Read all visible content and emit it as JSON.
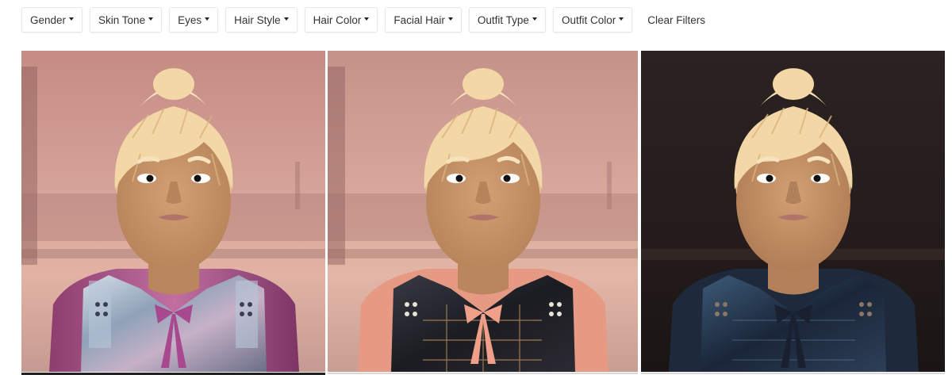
{
  "filters": [
    {
      "label": "Gender"
    },
    {
      "label": "Skin Tone"
    },
    {
      "label": "Eyes"
    },
    {
      "label": "Hair Style"
    },
    {
      "label": "Hair Color"
    },
    {
      "label": "Facial Hair"
    },
    {
      "label": "Outfit Type"
    },
    {
      "label": "Outfit Color"
    }
  ],
  "clear_filters": "Clear Filters",
  "cards": [
    {
      "background": "sunset",
      "outfit": "silver-pink metallic vest",
      "bow_color": "#a8488e"
    },
    {
      "background": "sunset",
      "outfit": "black leather vest with pink shirt",
      "bow_color": "#f0a088"
    },
    {
      "background": "dark",
      "outfit": "dark blue leather vest",
      "bow_color": "#1a2030"
    }
  ],
  "colors": {
    "button_border": "#e7e7e7",
    "text": "#333333",
    "skin": "#c89468",
    "hair": "#f3d7a6"
  }
}
